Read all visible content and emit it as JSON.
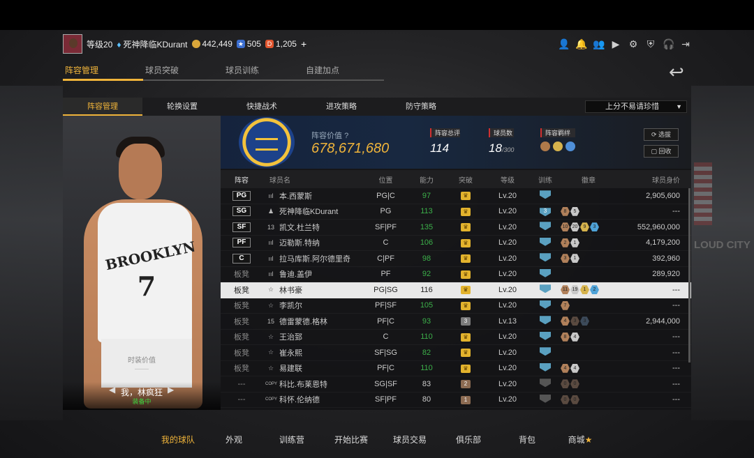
{
  "user": {
    "level": "等级20",
    "name": "死神降临KDurant",
    "coins": "442,449",
    "stars": "505",
    "diamonds": "1,205",
    "plus": "+"
  },
  "main_tabs": [
    "阵容管理",
    "球员突破",
    "球员训练",
    "自建加点"
  ],
  "sub_tabs": [
    "阵容管理",
    "轮换设置",
    "快捷战术",
    "进攻策略",
    "防守策略"
  ],
  "dropdown": "上分不易请珍惜",
  "summary": {
    "value_label": "阵容价值",
    "value": "678,671,680",
    "rating_label": "阵容总评",
    "rating": "114",
    "count_label": "球员数",
    "count": "18",
    "count_max": "/300",
    "bond_label": "阵容羁绊",
    "select_btn": "选拔",
    "recycle_btn": "回收"
  },
  "card": {
    "jersey_text": "BROOKLYN",
    "jersey_number": "7",
    "value_label": "时装价值",
    "value": "——",
    "name": "我，林疯狂",
    "status": "装备中"
  },
  "table": {
    "headers": [
      "阵容",
      "球员名",
      "位置",
      "能力",
      "突破",
      "等级",
      "训练",
      "徽章",
      "球员身价"
    ],
    "rows": [
      {
        "slot": "PG",
        "starter": true,
        "icon": "bars",
        "name": "本.西蒙斯",
        "pos": "PG|C",
        "ability": "97",
        "green": true,
        "breakthrough": "crown",
        "level": "Lv.20",
        "train": "",
        "badges": [],
        "value": "2,905,600"
      },
      {
        "slot": "SG",
        "starter": true,
        "icon": "person",
        "name": "死神降临KDurant",
        "pos": "PG",
        "ability": "113",
        "green": true,
        "breakthrough": "crown",
        "level": "Lv.20",
        "train": "3",
        "badges": [
          [
            "8",
            "b-brz"
          ],
          [
            "5",
            "b-slv"
          ]
        ],
        "value": "---"
      },
      {
        "slot": "SF",
        "starter": true,
        "icon": "13",
        "name": "凯文.杜兰特",
        "pos": "SF|PF",
        "ability": "135",
        "green": true,
        "breakthrough": "crown",
        "level": "Lv.20",
        "train": "",
        "badges": [
          [
            "10",
            "b-brz"
          ],
          [
            "20",
            "b-slv"
          ],
          [
            "9",
            "b-gld"
          ],
          [
            "3",
            "b-blu"
          ]
        ],
        "value": "552,960,000"
      },
      {
        "slot": "PF",
        "starter": true,
        "icon": "bars",
        "name": "迈勒斯.特纳",
        "pos": "C",
        "ability": "106",
        "green": true,
        "breakthrough": "crown",
        "level": "Lv.20",
        "train": "",
        "badges": [
          [
            "2",
            "b-brz"
          ],
          [
            "1",
            "b-slv"
          ]
        ],
        "value": "4,179,200"
      },
      {
        "slot": "C",
        "starter": true,
        "icon": "bars",
        "name": "拉马库斯.阿尔德里奇",
        "pos": "C|PF",
        "ability": "98",
        "green": true,
        "breakthrough": "crown",
        "level": "Lv.20",
        "train": "",
        "badges": [
          [
            "3",
            "b-brz"
          ],
          [
            "1",
            "b-slv"
          ]
        ],
        "value": "392,960"
      },
      {
        "slot": "板凳",
        "starter": false,
        "icon": "bars",
        "name": "鲁迪.盖伊",
        "pos": "PF",
        "ability": "92",
        "green": true,
        "breakthrough": "crown",
        "level": "Lv.20",
        "train": "",
        "badges": [],
        "value": "289,920"
      },
      {
        "slot": "板凳",
        "starter": false,
        "icon": "star",
        "name": "林书豪",
        "pos": "PG|SG",
        "ability": "116",
        "green": false,
        "breakthrough": "crown",
        "level": "Lv.20",
        "train": "",
        "badges": [
          [
            "11",
            "b-brz"
          ],
          [
            "19",
            "b-slv"
          ],
          [
            "1",
            "b-gld"
          ],
          [
            "2",
            "b-blu"
          ]
        ],
        "value": "---",
        "highlight": true
      },
      {
        "slot": "板凳",
        "starter": false,
        "icon": "star",
        "name": "李凯尔",
        "pos": "PF|SF",
        "ability": "105",
        "green": true,
        "breakthrough": "crown",
        "level": "Lv.20",
        "train": "",
        "badges": [
          [
            "7",
            "b-brz"
          ]
        ],
        "value": "---"
      },
      {
        "slot": "板凳",
        "starter": false,
        "icon": "15",
        "name": "德雷蒙德.格林",
        "pos": "PF|C",
        "ability": "93",
        "green": true,
        "breakthrough": "3",
        "level": "Lv.13",
        "train": "",
        "badges": [
          [
            "4",
            "b-brz"
          ],
          [
            "3",
            "b-dk"
          ],
          [
            "3",
            "b-dkb"
          ]
        ],
        "value": "2,944,000"
      },
      {
        "slot": "板凳",
        "starter": false,
        "icon": "star",
        "name": "王治郅",
        "pos": "C",
        "ability": "110",
        "green": true,
        "breakthrough": "crown",
        "level": "Lv.20",
        "train": "",
        "badges": [
          [
            "8",
            "b-brz"
          ],
          [
            "4",
            "b-slv"
          ]
        ],
        "value": "---"
      },
      {
        "slot": "板凳",
        "starter": false,
        "icon": "star",
        "name": "崔永熙",
        "pos": "SF|SG",
        "ability": "82",
        "green": true,
        "breakthrough": "crown",
        "level": "Lv.20",
        "train": "",
        "badges": [],
        "value": "---"
      },
      {
        "slot": "板凳",
        "starter": false,
        "icon": "star",
        "name": "易建联",
        "pos": "PF|C",
        "ability": "110",
        "green": true,
        "breakthrough": "crown",
        "level": "Lv.20",
        "train": "",
        "badges": [
          [
            "4",
            "b-brz"
          ],
          [
            "4",
            "b-slv"
          ]
        ],
        "value": "---"
      },
      {
        "slot": "---",
        "starter": false,
        "icon": "COPY",
        "name": "科比.布莱恩特",
        "pos": "SG|SF",
        "ability": "83",
        "green": false,
        "breakthrough": "2",
        "level": "Lv.20",
        "train": "",
        "dimTrain": true,
        "badges": [
          [
            "0",
            "b-dk"
          ],
          [
            "0",
            "b-dk"
          ]
        ],
        "value": "---"
      },
      {
        "slot": "---",
        "starter": false,
        "icon": "COPY",
        "name": "科怀.伦纳德",
        "pos": "SF|PF",
        "ability": "80",
        "green": false,
        "breakthrough": "1",
        "level": "Lv.20",
        "train": "",
        "dimTrain": true,
        "badges": [
          [
            "0",
            "b-dk"
          ],
          [
            "0",
            "b-dk"
          ]
        ],
        "value": "---"
      }
    ]
  },
  "bottom_nav": [
    "我的球队",
    "外观",
    "训练营",
    "开始比赛",
    "球员交易",
    "俱乐部",
    "背包",
    "商城"
  ],
  "arena_sign": "LOUD CITY",
  "colors": {
    "accent": "#f0b43a",
    "green": "#3cb04a",
    "warriors_blue": "#1d428a",
    "warriors_gold": "#f3c23c"
  }
}
